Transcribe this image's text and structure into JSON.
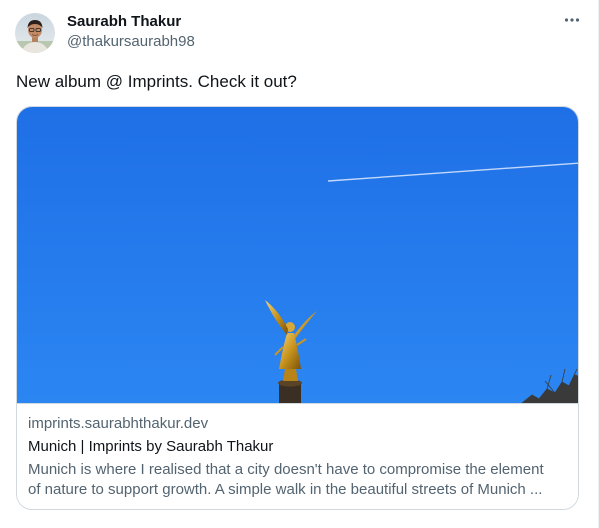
{
  "author": {
    "display_name": "Saurabh Thakur",
    "handle": "@thakursaurabh98"
  },
  "tweet": {
    "text": "New album @ Imprints. Check it out?"
  },
  "link_card": {
    "domain": "imprints.saurabhthakur.dev",
    "title": "Munich | Imprints by Saurabh Thakur",
    "description_line1": "Munich is where I realised that a city doesn't have to compromise the element",
    "description_line2": "of nature to support growth. A simple walk in the beautiful streets of Munich ..."
  },
  "icons": {
    "more": "more-horizontal-icon"
  },
  "colors": {
    "text_primary": "#0f1419",
    "text_secondary": "#536471",
    "border": "#cfd9de",
    "sky": "#1c6ee8"
  }
}
